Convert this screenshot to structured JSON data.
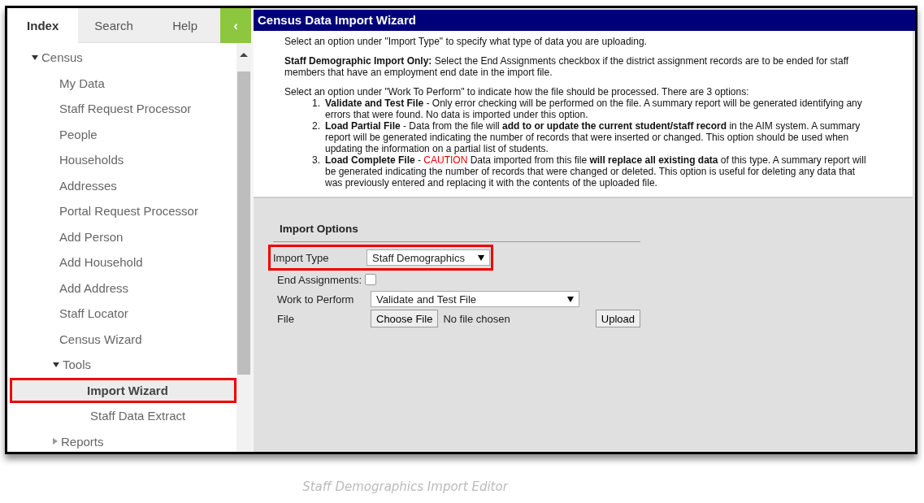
{
  "sidebar": {
    "tabs": [
      {
        "label": "Index",
        "selected": true
      },
      {
        "label": "Search",
        "selected": false
      },
      {
        "label": "Help",
        "selected": false
      }
    ],
    "collapse_button": "‹",
    "tree": [
      {
        "label": "Census",
        "expanded": true,
        "selected": false,
        "children": [
          {
            "label": "My Data",
            "selected": false
          },
          {
            "label": "Staff Request Processor",
            "selected": false
          },
          {
            "label": "People",
            "selected": false
          },
          {
            "label": "Households",
            "selected": false
          },
          {
            "label": "Addresses",
            "selected": false
          },
          {
            "label": "Portal Request Processor",
            "selected": false
          },
          {
            "label": "Add Person",
            "selected": false
          },
          {
            "label": "Add Household",
            "selected": false
          },
          {
            "label": "Add Address",
            "selected": false
          },
          {
            "label": "Staff Locator",
            "selected": false
          },
          {
            "label": "Census Wizard",
            "selected": false
          },
          {
            "label": "Tools",
            "expanded": true,
            "selected": false,
            "children": [
              {
                "label": "Import Wizard",
                "selected": true
              },
              {
                "label": "Staff Data Extract",
                "selected": false
              }
            ]
          },
          {
            "label": "Reports",
            "expanded": false,
            "selected": false
          }
        ]
      }
    ]
  },
  "main": {
    "title": "Census Data Import Wizard",
    "intro": "Select an option under \"Import Type\" to specify what type of data you are uploading.",
    "staff_note": "**Staff Demographic Import Only:** Select the End Assignments checkbox if the district assignment records are to be ended for staff members that have an employment end date in the import file.",
    "work_intro": "Select an option under \"Work To Perform\" to indicate how the file should be processed. There are 3 options:",
    "options": [
      {
        "number": "1.",
        "title": "Validate and Test File",
        "text": "- Only error checking will be performed on the file. A summary report will be generated identifying any errors that were found. No data is imported under this option."
      },
      {
        "number": "2.",
        "title": "Load Partial File",
        "text": "- Data from the file will **add to or update the current student/staff record** in the AIM system. A summary report will be generated indicating the number of records that were inserted or changed. This option should be used when updating the information on a partial list of students."
      },
      {
        "number": "3.",
        "title": "Load Complete File",
        "text": "-",
        "caution": "CAUTION",
        "text_after": "Data imported from this file **will replace all existing data** of this type. A summary report will be generated indicating the number of records that were changed or deleted. This option is useful for deleting any data that was previously entered and replacing it with the contents of the uploaded file."
      }
    ],
    "import_options": {
      "heading": "Import Options",
      "import_type": {
        "label": "Import Type",
        "value": "Staff Demographics",
        "highlighted": true
      },
      "end_assignments": {
        "label": "End Assignments:",
        "checked": false
      },
      "work_to_perform": {
        "label": "Work to Perform",
        "value": "Validate and Test File"
      },
      "file": {
        "label": "File",
        "choose_button": "Choose File",
        "status": "No file chosen",
        "upload_button": "Upload"
      }
    }
  },
  "caption": "Staff Demographics Import Editor"
}
